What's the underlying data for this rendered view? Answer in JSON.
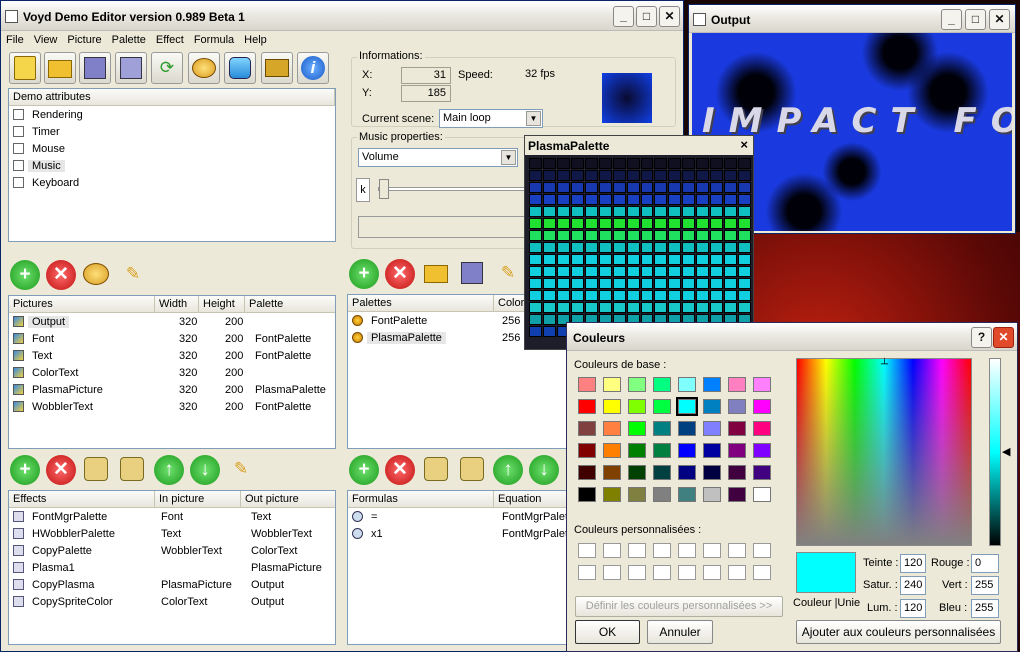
{
  "main": {
    "title": "Voyd Demo Editor version 0.989 Beta 1",
    "menu": [
      "File",
      "View",
      "Picture",
      "Palette",
      "Effect",
      "Formula",
      "Help"
    ],
    "toolbar_icons": [
      "new-document-icon",
      "open-folder-icon",
      "save-icon",
      "save-as-icon",
      "refresh-icon",
      "palette-icon",
      "effect-icon",
      "media-icon",
      "info-icon"
    ],
    "demo_attributes": {
      "header": "Demo attributes",
      "items": [
        "Rendering",
        "Timer",
        "Mouse",
        "Music",
        "Keyboard"
      ],
      "selected": "Music"
    },
    "info": {
      "group_label": "Informations:",
      "x_label": "X:",
      "x_value": "31",
      "y_label": "Y:",
      "y_value": "185",
      "speed_label": "Speed:",
      "speed_value": "32 fps",
      "scene_label": "Current scene:",
      "scene_value": "Main loop",
      "music_group": "Music properties:",
      "music_select": "Volume",
      "slider_char": "k"
    },
    "pictures": {
      "headers": [
        "Pictures",
        "Width",
        "Height",
        "Palette"
      ],
      "rows": [
        [
          "Output",
          "320",
          "200",
          ""
        ],
        [
          "Font",
          "320",
          "200",
          "FontPalette"
        ],
        [
          "Text",
          "320",
          "200",
          "FontPalette"
        ],
        [
          "ColorText",
          "320",
          "200",
          ""
        ],
        [
          "PlasmaPicture",
          "320",
          "200",
          "PlasmaPalette"
        ],
        [
          "WobblerText",
          "320",
          "200",
          "FontPalette"
        ]
      ]
    },
    "palettes": {
      "headers": [
        "Palettes",
        "Color"
      ],
      "rows": [
        [
          "FontPalette",
          "256"
        ],
        [
          "PlasmaPalette",
          "256"
        ]
      ]
    },
    "effects": {
      "headers": [
        "Effects",
        "In picture",
        "Out picture"
      ],
      "rows": [
        [
          "FontMgrPalette",
          "Font",
          "Text"
        ],
        [
          "HWobblerPalette",
          "Text",
          "WobblerText"
        ],
        [
          "CopyPalette",
          "WobblerText",
          "ColorText"
        ],
        [
          "Plasma1",
          "",
          "PlasmaPicture"
        ],
        [
          "CopyPlasma",
          "PlasmaPicture",
          "Output"
        ],
        [
          "CopySpriteColor",
          "ColorText",
          "Output"
        ]
      ]
    },
    "formulas": {
      "headers": [
        "Formulas",
        "Equation"
      ],
      "rows": [
        [
          "=",
          "FontMgrPalett"
        ],
        [
          "x1",
          "FontMgrPalett"
        ]
      ]
    }
  },
  "output": {
    "title": "Output",
    "text": "IMPACT FOR"
  },
  "plasma_palette": {
    "title": "PlasmaPalette",
    "close": "×"
  },
  "couleurs": {
    "title": "Couleurs",
    "help": "?",
    "close": "✕",
    "base_label": "Couleurs de base :",
    "base_colors": [
      "#ff8080",
      "#ffff80",
      "#80ff80",
      "#00ff80",
      "#80ffff",
      "#0080ff",
      "#ff80c0",
      "#ff80ff",
      "#ff0000",
      "#ffff00",
      "#80ff00",
      "#00ff40",
      "#00ffff",
      "#0080c0",
      "#8080c0",
      "#ff00ff",
      "#804040",
      "#ff8040",
      "#00ff00",
      "#008080",
      "#004080",
      "#8080ff",
      "#800040",
      "#ff0080",
      "#800000",
      "#ff8000",
      "#008000",
      "#008040",
      "#0000ff",
      "#0000a0",
      "#800080",
      "#8000ff",
      "#400000",
      "#804000",
      "#004000",
      "#004040",
      "#000080",
      "#000040",
      "#400040",
      "#400080",
      "#000000",
      "#808000",
      "#808040",
      "#808080",
      "#408080",
      "#c0c0c0",
      "#400040",
      "#ffffff"
    ],
    "custom_label": "Couleurs personnalisées :",
    "define_button": "Définir les couleurs personnalisées >>",
    "ok": "OK",
    "cancel": "Annuler",
    "solid_label": "Couleur |Unie",
    "teinte_label": "Teinte :",
    "teinte": "120",
    "satur_label": "Satur. :",
    "satur": "240",
    "lum_label": "Lum. :",
    "lum": "120",
    "rouge_label": "Rouge :",
    "rouge": "0",
    "vert_label": "Vert :",
    "vert": "255",
    "bleu_label": "Bleu :",
    "bleu": "255",
    "add_button": "Ajouter aux couleurs personnalisées",
    "current_color": "#00ffff"
  }
}
